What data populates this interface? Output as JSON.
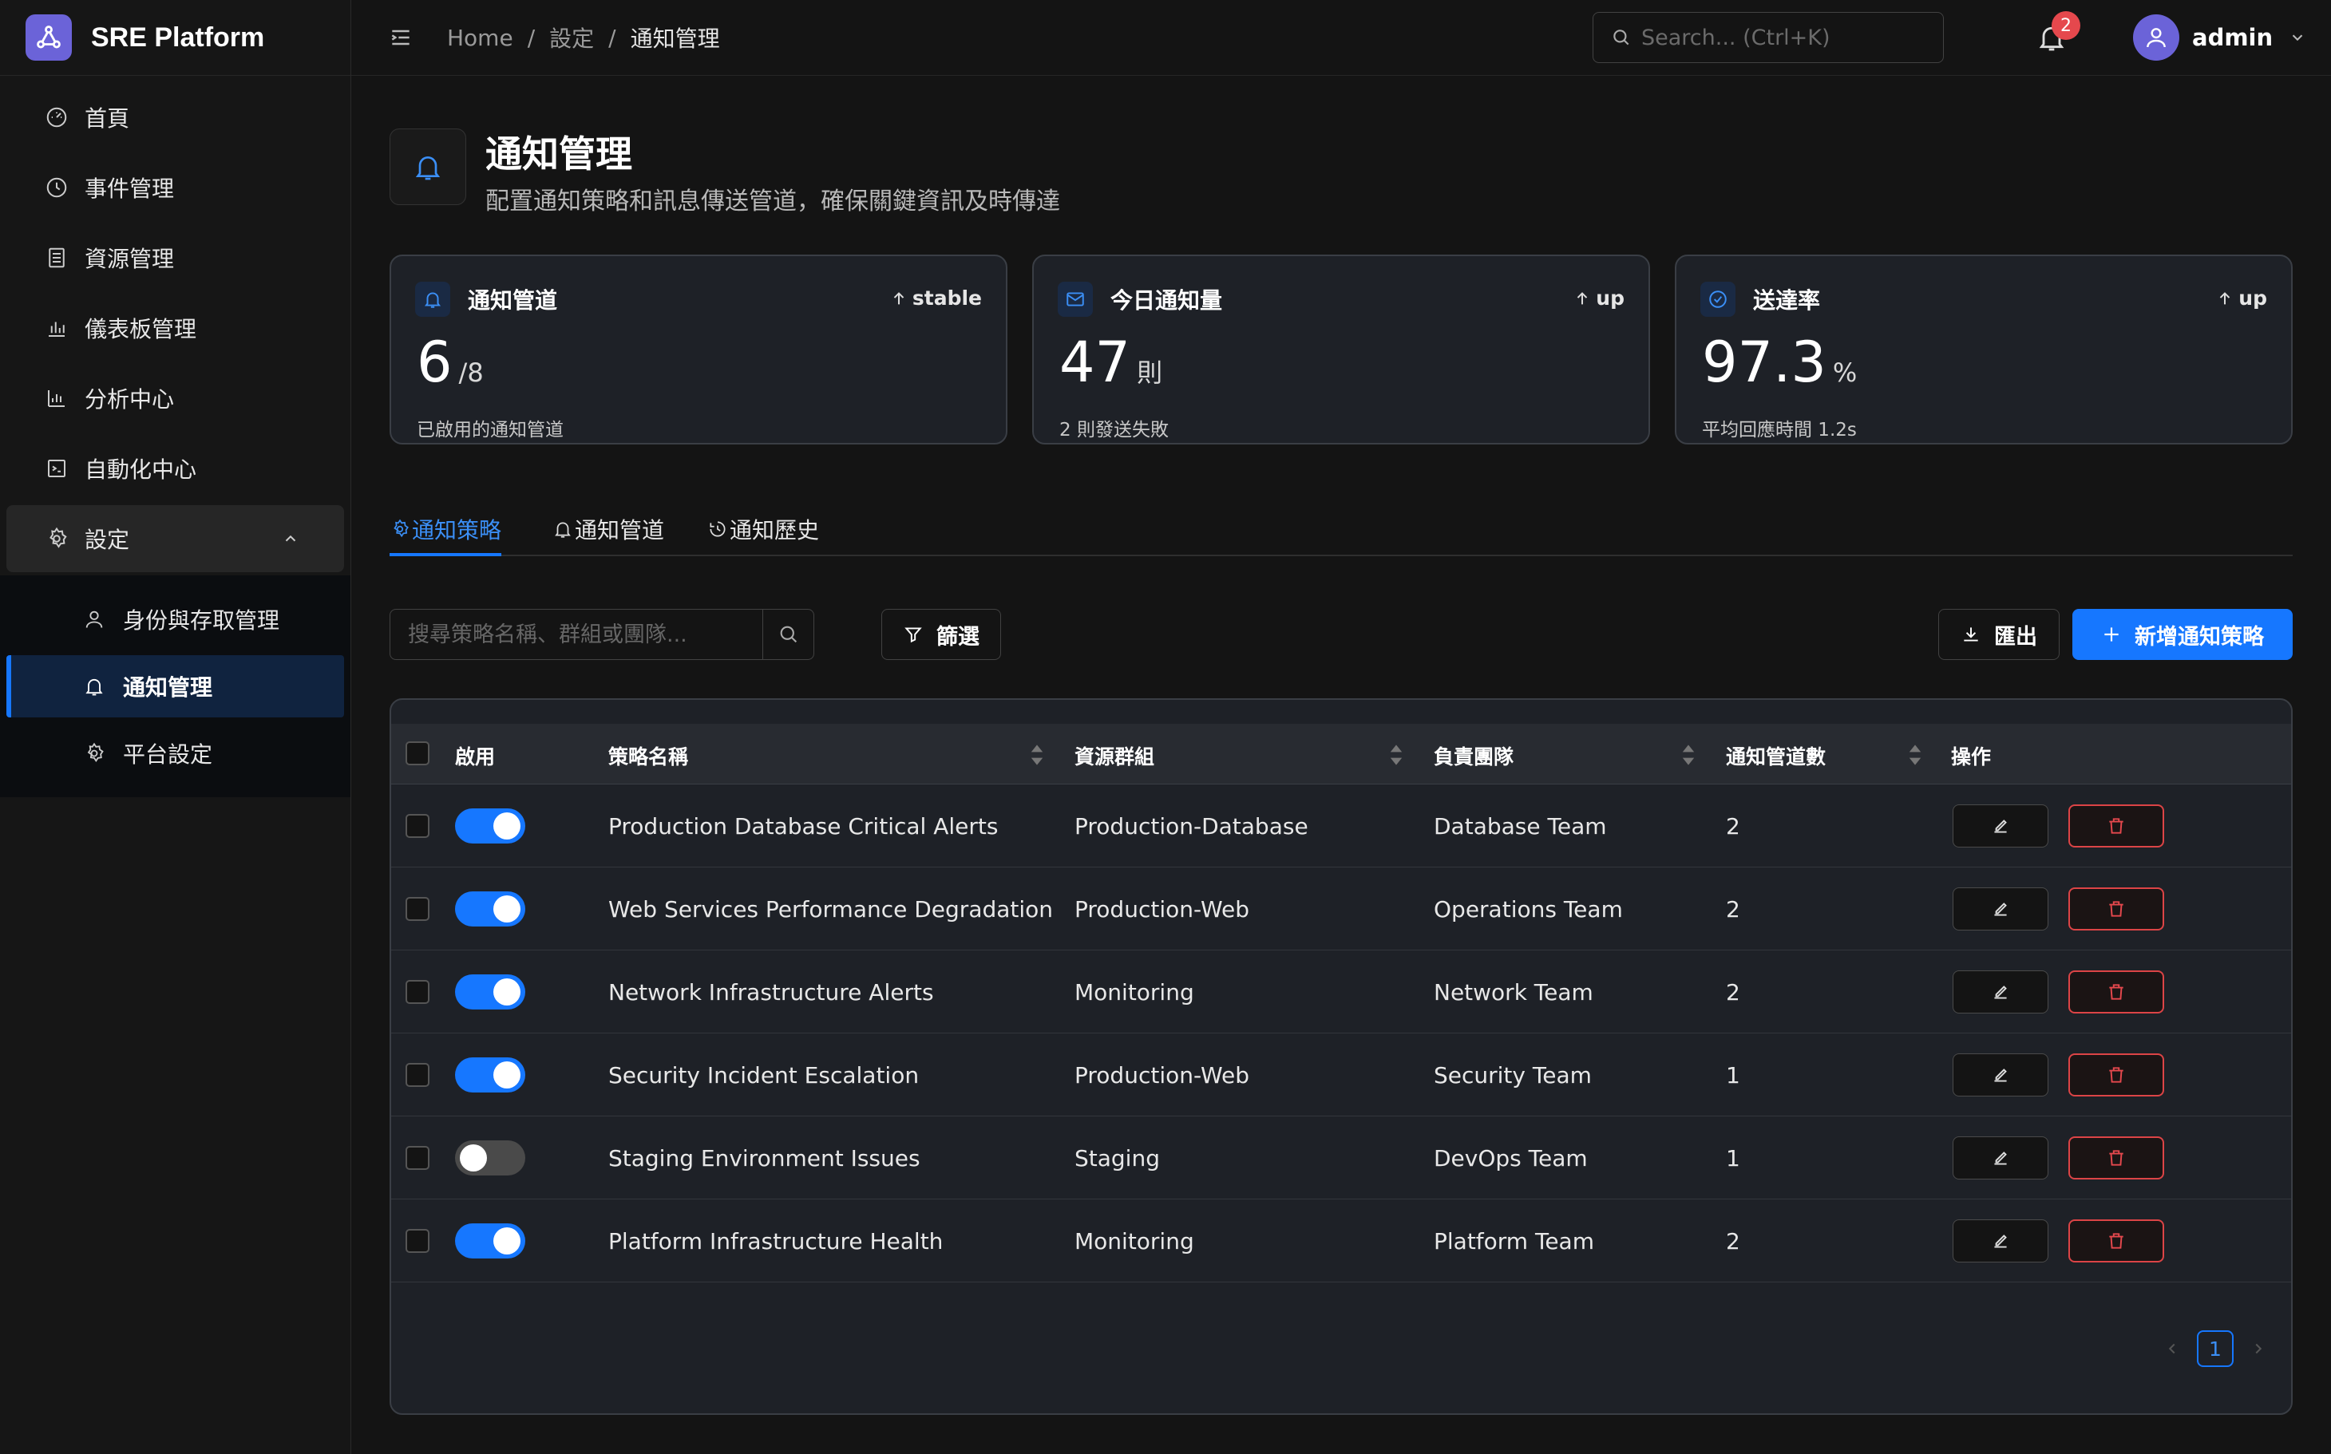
{
  "app": {
    "name": "SRE Platform"
  },
  "sidebar": {
    "items": [
      {
        "label": "首頁",
        "icon": "dashboard-icon"
      },
      {
        "label": "事件管理",
        "icon": "clock-icon"
      },
      {
        "label": "資源管理",
        "icon": "database-icon"
      },
      {
        "label": "儀表板管理",
        "icon": "bar-chart-icon"
      },
      {
        "label": "分析中心",
        "icon": "line-chart-icon"
      },
      {
        "label": "自動化中心",
        "icon": "code-icon"
      },
      {
        "label": "設定",
        "icon": "gear-icon",
        "expanded": true
      }
    ],
    "subitems": [
      {
        "label": "身份與存取管理",
        "icon": "user-icon"
      },
      {
        "label": "通知管理",
        "icon": "bell-icon",
        "active": true
      },
      {
        "label": "平台設定",
        "icon": "gear-icon"
      }
    ]
  },
  "header": {
    "breadcrumb": [
      "Home",
      "設定",
      "通知管理"
    ],
    "search_placeholder": "Search... (Ctrl+K)",
    "notification_count": "2",
    "username": "admin"
  },
  "page": {
    "title": "通知管理",
    "subtitle": "配置通知策略和訊息傳送管道，確保關鍵資訊及時傳達"
  },
  "stats": [
    {
      "label": "通知管道",
      "trend": "stable",
      "value": "6",
      "unit": "/8",
      "desc": "已啟用的通知管道",
      "icon": "bell-icon"
    },
    {
      "label": "今日通知量",
      "trend": "up",
      "value": "47",
      "unit": "則",
      "desc": "2 則發送失敗",
      "icon": "mail-icon"
    },
    {
      "label": "送達率",
      "trend": "up",
      "value": "97.3",
      "unit": "%",
      "desc": "平均回應時間 1.2s",
      "icon": "check-circle-icon"
    }
  ],
  "tabs": [
    {
      "label": "通知策略",
      "icon": "gear-icon"
    },
    {
      "label": "通知管道",
      "icon": "bell-icon"
    },
    {
      "label": "通知歷史",
      "icon": "history-icon"
    }
  ],
  "toolbar": {
    "search_placeholder": "搜尋策略名稱、群組或團隊...",
    "filter_label": "篩選",
    "export_label": "匯出",
    "add_label": "新增通知策略"
  },
  "table": {
    "columns": [
      "啟用",
      "策略名稱",
      "資源群組",
      "負責團隊",
      "通知管道數",
      "操作"
    ],
    "rows": [
      {
        "enabled": true,
        "name": "Production Database Critical Alerts",
        "group": "Production-Database",
        "team": "Database Team",
        "channels": "2"
      },
      {
        "enabled": true,
        "name": "Web Services Performance Degradation",
        "group": "Production-Web",
        "team": "Operations Team",
        "channels": "2"
      },
      {
        "enabled": true,
        "name": "Network Infrastructure Alerts",
        "group": "Monitoring",
        "team": "Network Team",
        "channels": "2"
      },
      {
        "enabled": true,
        "name": "Security Incident Escalation",
        "group": "Production-Web",
        "team": "Security Team",
        "channels": "1"
      },
      {
        "enabled": false,
        "name": "Staging Environment Issues",
        "group": "Staging",
        "team": "DevOps Team",
        "channels": "1"
      },
      {
        "enabled": true,
        "name": "Platform Infrastructure Health",
        "group": "Monitoring",
        "team": "Platform Team",
        "channels": "2"
      }
    ]
  },
  "pagination": {
    "current": "1"
  },
  "colors": {
    "accent": "#1677ff",
    "danger": "#dc4446",
    "brand": "#6b63d8"
  }
}
